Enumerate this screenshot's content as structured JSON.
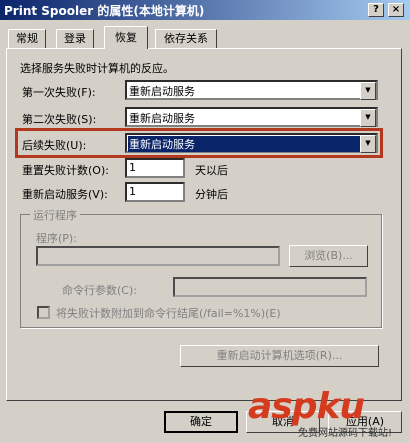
{
  "window": {
    "title": "Print Spooler 的属性(本地计算机)",
    "help_btn": "?",
    "close_btn": "×"
  },
  "tabs": [
    {
      "label": "常规"
    },
    {
      "label": "登录"
    },
    {
      "label": "恢复"
    },
    {
      "label": "依存关系"
    }
  ],
  "recovery": {
    "intro": "选择服务失败时计算机的反应。",
    "first_failure_label": "第一次失败(F):",
    "first_failure_value": "重新启动服务",
    "second_failure_label": "第二次失败(S):",
    "second_failure_value": "重新启动服务",
    "subsequent_label": "后续失败(U):",
    "subsequent_value": "重新启动服务",
    "reset_count_label": "重置失败计数(O):",
    "reset_count_value": "1",
    "reset_count_unit": "天以后",
    "restart_service_label": "重新启动服务(V):",
    "restart_service_value": "1",
    "restart_service_unit": "分钟后"
  },
  "run_program": {
    "group_title": "运行程序",
    "program_label": "程序(P):",
    "browse_label": "浏览(B)...",
    "cmd_params_label": "命令行参数(C):",
    "append_checkbox_label": "将失败计数附加到命令行结尾(/fail=%1%)(E)"
  },
  "restart_options_label": "重新启动计算机选项(R)...",
  "footer": {
    "ok_label": "确定",
    "cancel_label": "取消",
    "apply_label": "应用(A)"
  },
  "watermark": {
    "brand": "aspku",
    "tagline": "免费网站源码下载站!"
  },
  "colors": {
    "highlight_border": "#b3391e",
    "selection": "#0a246a",
    "watermark": "#d43b1f"
  }
}
